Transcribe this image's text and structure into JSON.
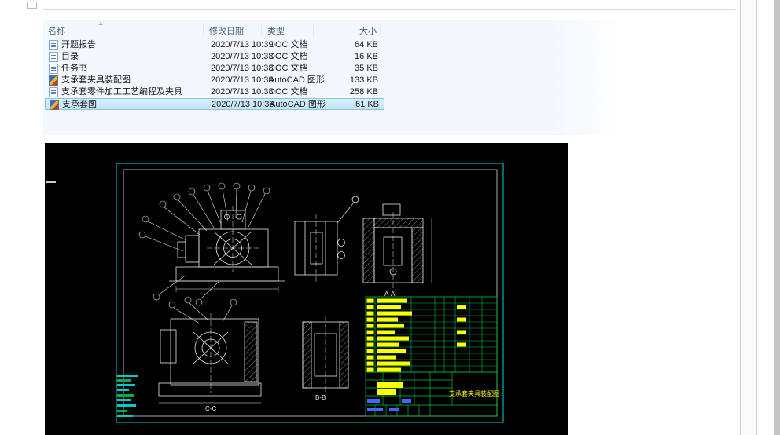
{
  "file_list": {
    "columns": [
      {
        "label": "名称",
        "sorted": true
      },
      {
        "label": "修改日期"
      },
      {
        "label": "类型"
      },
      {
        "label": "大小"
      }
    ],
    "rows": [
      {
        "name": "开题报告",
        "date": "2020/7/13 10:39",
        "type": "DOC 文档",
        "size": "64 KB",
        "icon": "doc",
        "selected": false
      },
      {
        "name": "目录",
        "date": "2020/7/13 10:38",
        "type": "DOC 文档",
        "size": "16 KB",
        "icon": "doc",
        "selected": false
      },
      {
        "name": "任务书",
        "date": "2020/7/13 10:38",
        "type": "DOC 文档",
        "size": "35 KB",
        "icon": "doc",
        "selected": false
      },
      {
        "name": "支承套夹具装配图",
        "date": "2020/7/13 10:38",
        "type": "AutoCAD 图形",
        "size": "133 KB",
        "icon": "cad",
        "selected": false
      },
      {
        "name": "支承套零件加工工艺编程及夹具",
        "date": "2020/7/13 10:38",
        "type": "DOC 文档",
        "size": "258 KB",
        "icon": "doc",
        "selected": false
      },
      {
        "name": "支承套图",
        "date": "2020/7/13 10:38",
        "type": "AutoCAD 图形",
        "size": "61 KB",
        "icon": "cad",
        "selected": true
      }
    ]
  },
  "cad": {
    "colors": {
      "background": "#000000",
      "frame": "#00d6d6",
      "lines": "#e6e6e6",
      "table": "#00c23c",
      "highlight": "#ffff00",
      "accent_blue": "#3a6cff"
    },
    "section_labels": {
      "a": "A-A",
      "b": "B-B",
      "c": "C-C"
    },
    "title_text": "支承套夹具装配图",
    "bom": {
      "rows": 12,
      "name_bar_widths": [
        38,
        30,
        44,
        26,
        34,
        22,
        40,
        28,
        36,
        24,
        42,
        30
      ],
      "extra_cell_rows": [
        1,
        3,
        5,
        7
      ]
    }
  }
}
